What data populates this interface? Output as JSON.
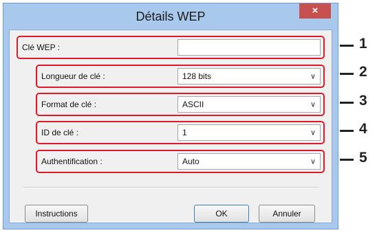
{
  "window": {
    "title": "Détails WEP",
    "close_label": "×"
  },
  "fields": [
    {
      "label": "Clé WEP :",
      "value": ""
    },
    {
      "label": "Longueur de clé :",
      "value": "128 bits"
    },
    {
      "label": "Format de clé :",
      "value": "ASCII"
    },
    {
      "label": "ID de clé :",
      "value": "1"
    },
    {
      "label": "Authentification :",
      "value": "Auto"
    }
  ],
  "callouts": [
    "1",
    "2",
    "3",
    "4",
    "5"
  ],
  "buttons": {
    "instructions": "Instructions",
    "ok": "OK",
    "cancel": "Annuler"
  },
  "icons": {
    "dropdown": "chevron-down-icon",
    "close": "close-icon"
  },
  "colors": {
    "highlight": "#e0192a",
    "titlebar": "#a9c9ec",
    "close": "#c75050"
  }
}
